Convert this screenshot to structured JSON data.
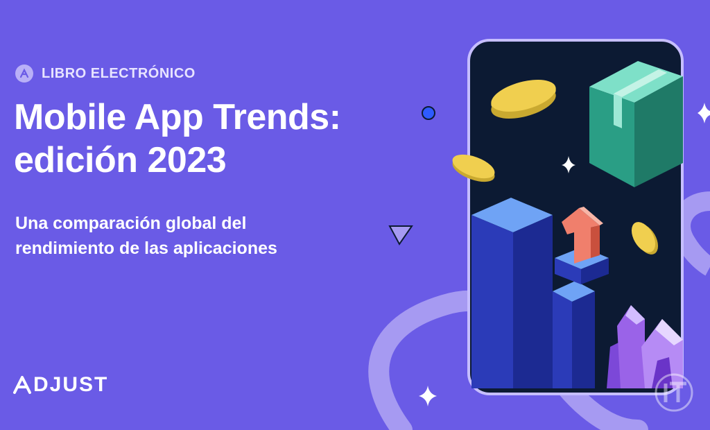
{
  "eyebrow": {
    "label": "LIBRO ELECTRÓNICO",
    "icon": "adjust-a-badge-icon"
  },
  "title": {
    "line1": "Mobile App Trends:",
    "line2": "edición 2023"
  },
  "subtitle": {
    "line1": "Una comparación global del",
    "line2": "rendimiento de las aplicaciones"
  },
  "brand": {
    "name": "DJUST"
  },
  "colors": {
    "background": "#6a5be6",
    "phone_screen": "#0c1a33",
    "accent_lavender": "#b9b0f7",
    "coin": "#f0cf4f",
    "box": "#2fa58a",
    "pillar": "#2b3bb8",
    "arrow": "#f07f6c",
    "crystal": "#9a63e8"
  }
}
